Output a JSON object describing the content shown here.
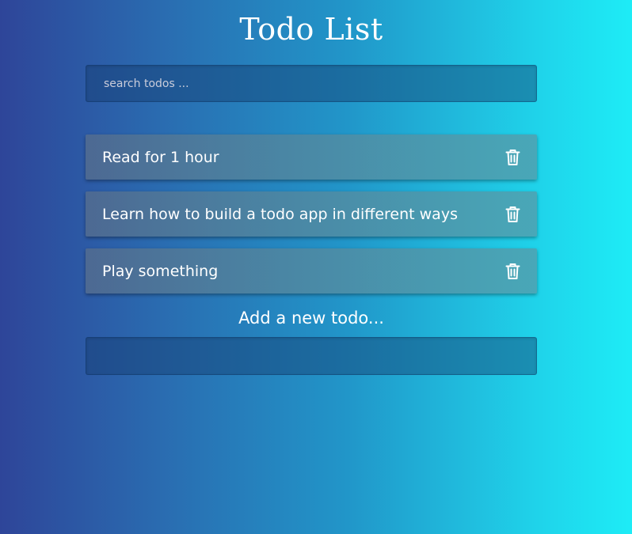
{
  "header": {
    "title": "Todo List"
  },
  "search": {
    "placeholder": "search todos ...",
    "value": ""
  },
  "todos": [
    {
      "text": "Read for 1 hour",
      "icon": "trash-icon"
    },
    {
      "text": "Learn how to build a todo app in different ways",
      "icon": "trash-icon"
    },
    {
      "text": "Play something",
      "icon": "trash-icon"
    }
  ],
  "add_form": {
    "label": "Add a new todo...",
    "value": ""
  },
  "colors": {
    "gradient_start": "#2e4599",
    "gradient_end": "#1eecf6",
    "text": "#ffffff"
  }
}
